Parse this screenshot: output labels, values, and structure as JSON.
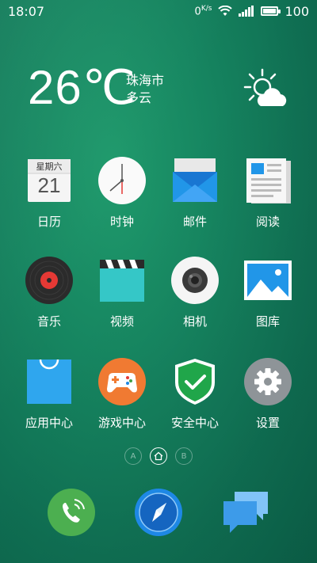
{
  "status_bar": {
    "time": "18:07",
    "net_speed": "0",
    "net_unit": "K/s",
    "battery_level": "100",
    "battery_percent": 100
  },
  "weather": {
    "temperature": "26℃",
    "city": "珠海市",
    "condition": "多云",
    "icon": "sun-cloud-icon"
  },
  "apps": [
    {
      "label": "日历",
      "icon": "calendar-icon",
      "calendar_weekday": "星期六",
      "calendar_day": "21"
    },
    {
      "label": "时钟",
      "icon": "clock-icon"
    },
    {
      "label": "邮件",
      "icon": "mail-icon"
    },
    {
      "label": "阅读",
      "icon": "reader-icon"
    },
    {
      "label": "音乐",
      "icon": "music-icon"
    },
    {
      "label": "视频",
      "icon": "video-icon"
    },
    {
      "label": "相机",
      "icon": "camera-icon"
    },
    {
      "label": "图库",
      "icon": "gallery-icon"
    },
    {
      "label": "应用中心",
      "icon": "app-store-icon"
    },
    {
      "label": "游戏中心",
      "icon": "game-center-icon"
    },
    {
      "label": "安全中心",
      "icon": "security-icon"
    },
    {
      "label": "设置",
      "icon": "settings-icon"
    }
  ],
  "page_indicators": [
    {
      "label": "A",
      "active": false
    },
    {
      "label": "home",
      "active": true
    },
    {
      "label": "B",
      "active": false
    }
  ],
  "dock": [
    {
      "name": "phone",
      "icon": "phone-icon"
    },
    {
      "name": "browser",
      "icon": "compass-icon"
    },
    {
      "name": "messages",
      "icon": "messages-icon"
    }
  ],
  "colors": {
    "background": "#168560",
    "mail_blue": "#2196e8",
    "app_store_blue": "#2fa6ee",
    "game_orange": "#f07a32",
    "security_green": "#20a64a",
    "settings_gray": "#8e9498",
    "phone_green": "#4caf50",
    "compass_blue": "#1e88e5",
    "messages_blue": "#4aa8f0"
  }
}
